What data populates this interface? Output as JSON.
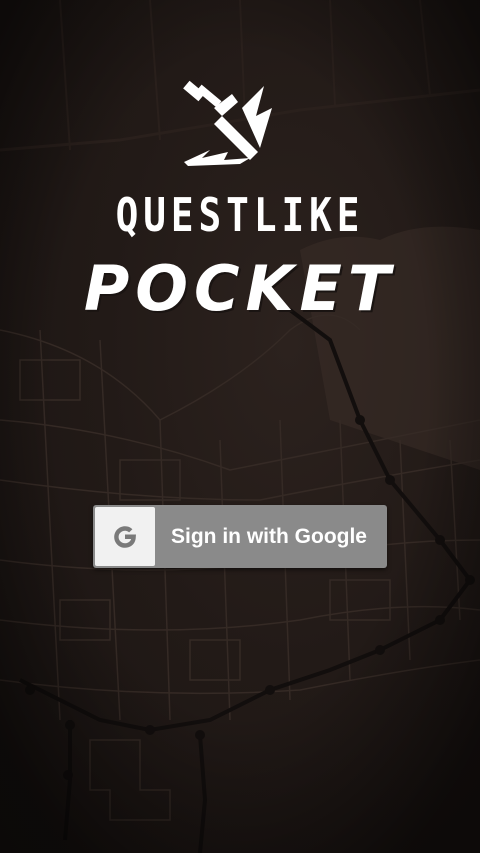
{
  "app": {
    "title_line1": "QUESTLIKE",
    "title_line2": "POCKET",
    "logo_icon": "sword-icon",
    "background": "map-background"
  },
  "signin": {
    "label": "Sign in with Google",
    "icon": "google-g-icon",
    "button_color": "#8a8a8a",
    "icon_bg_color": "#f1f1f1"
  },
  "colors": {
    "background": "#1f1816",
    "text": "#ffffff",
    "map_lines": "#3a2e29"
  }
}
